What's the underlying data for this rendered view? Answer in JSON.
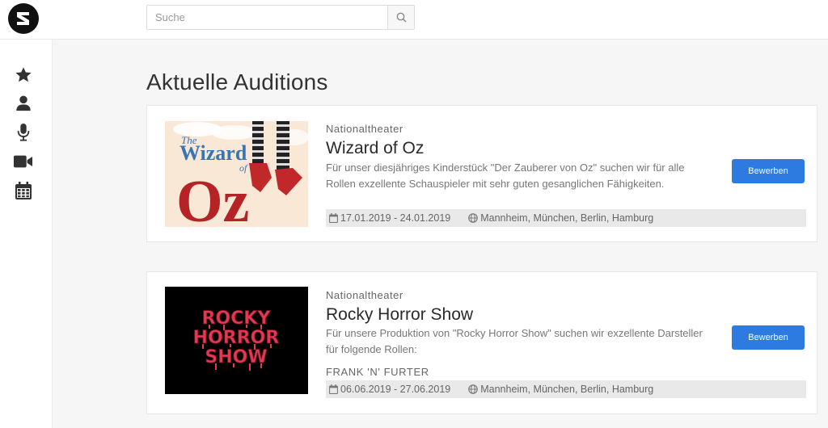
{
  "search": {
    "placeholder": "Suche"
  },
  "sidebar": {
    "items": [
      {
        "icon": "star-icon"
      },
      {
        "icon": "user-icon"
      },
      {
        "icon": "microphone-icon"
      },
      {
        "icon": "video-icon"
      },
      {
        "icon": "calendar-icon"
      }
    ]
  },
  "main": {
    "title": "Aktuelle Auditions",
    "auditions": [
      {
        "organization": "Nationaltheater",
        "title": "Wizard of Oz",
        "description": "Für unser diesjähriges Kinderstück \"Der Zauberer von Oz\" suchen wir für alle Rollen exzellente Schauspieler mit sehr guten gesanglichen Fähigkeiten.",
        "dates": "17.01.2019 - 24.01.2019",
        "locations": "Mannheim, München, Berlin, Hamburg",
        "apply_label": "Bewerben",
        "poster_text": {
          "the": "The",
          "wizard": "Wizard",
          "of": "of",
          "oz": "Oz"
        }
      },
      {
        "organization": "Nationaltheater",
        "title": "Rocky Horror Show",
        "description": "Für unsere Produktion von \"Rocky Horror Show\" suchen wir exzellente Darsteller für folgende Rollen:",
        "role": "FRANK 'N' FURTER",
        "dates": "06.06.2019 - 27.06.2019",
        "locations": "Mannheim, München, Berlin, Hamburg",
        "apply_label": "Bewerben",
        "poster_text": {
          "line1": "ROCKY",
          "line2": "HORROR",
          "line3": "SHOW"
        }
      }
    ]
  },
  "colors": {
    "accent": "#2d7be0",
    "poster_red": "#c0282a",
    "rocky_red": "#e03a55"
  }
}
